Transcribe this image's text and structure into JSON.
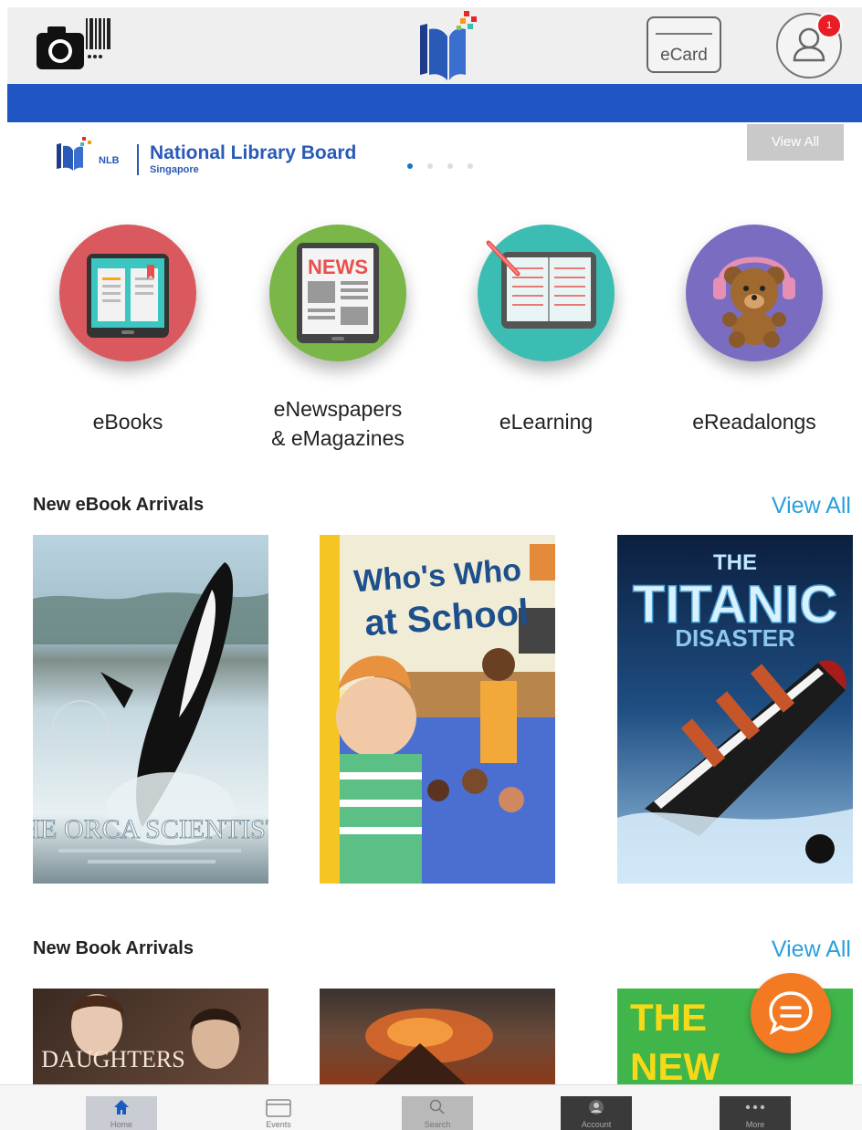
{
  "header": {
    "scan_icon": "camera-barcode-icon",
    "ecard_label": "eCard",
    "profile_icon": "user-icon",
    "notification_count": "1"
  },
  "banner": {
    "logo_short": "NLB",
    "org_name": "National Library Board",
    "org_location": "Singapore",
    "view_all": "View All",
    "slide_count": 4,
    "active_slide": 1
  },
  "categories": [
    {
      "label": "eBooks",
      "icon": "ebook-tablet-icon",
      "color": "#d9595f"
    },
    {
      "label": "eNewspapers\n& eMagazines",
      "icon": "newspaper-tablet-icon",
      "color": "#7ab648",
      "news_text": "NEWS"
    },
    {
      "label": "eLearning",
      "icon": "elearning-book-icon",
      "color": "#3bbdb3"
    },
    {
      "label": "eReadalongs",
      "icon": "teddy-bear-headphones-icon",
      "color": "#7a6cc0"
    }
  ],
  "ebook_section": {
    "title": "New eBook Arrivals",
    "view_all": "View All",
    "books": [
      {
        "title": "THE ORCA SCIENTISTS"
      },
      {
        "title_line1": "Who's Who",
        "title_line2": "at School"
      },
      {
        "title_line1": "THE",
        "title_line2": "TITANIC",
        "title_line3": "DISASTER"
      }
    ]
  },
  "book_section": {
    "title": "New Book Arrivals",
    "view_all": "View All",
    "books": [
      {
        "title": "DAUGHTERS"
      },
      {
        "title": ""
      },
      {
        "title_line1": "THE",
        "title_line2": "NEW"
      }
    ]
  },
  "chat": {
    "icon": "chat-bubble-icon"
  },
  "bottom_nav": [
    {
      "label": "Home",
      "icon": "home-icon"
    },
    {
      "label": "Events",
      "icon": "calendar-icon"
    },
    {
      "label": "Search",
      "icon": "search-icon"
    },
    {
      "label": "Account",
      "icon": "account-icon"
    },
    {
      "label": "More",
      "icon": "more-icon"
    }
  ],
  "colors": {
    "header_bg": "#efefef",
    "accent_blue": "#1f56c3",
    "link": "#2aa0dc",
    "chat": "#f37a22",
    "badge": "#e81d25"
  }
}
